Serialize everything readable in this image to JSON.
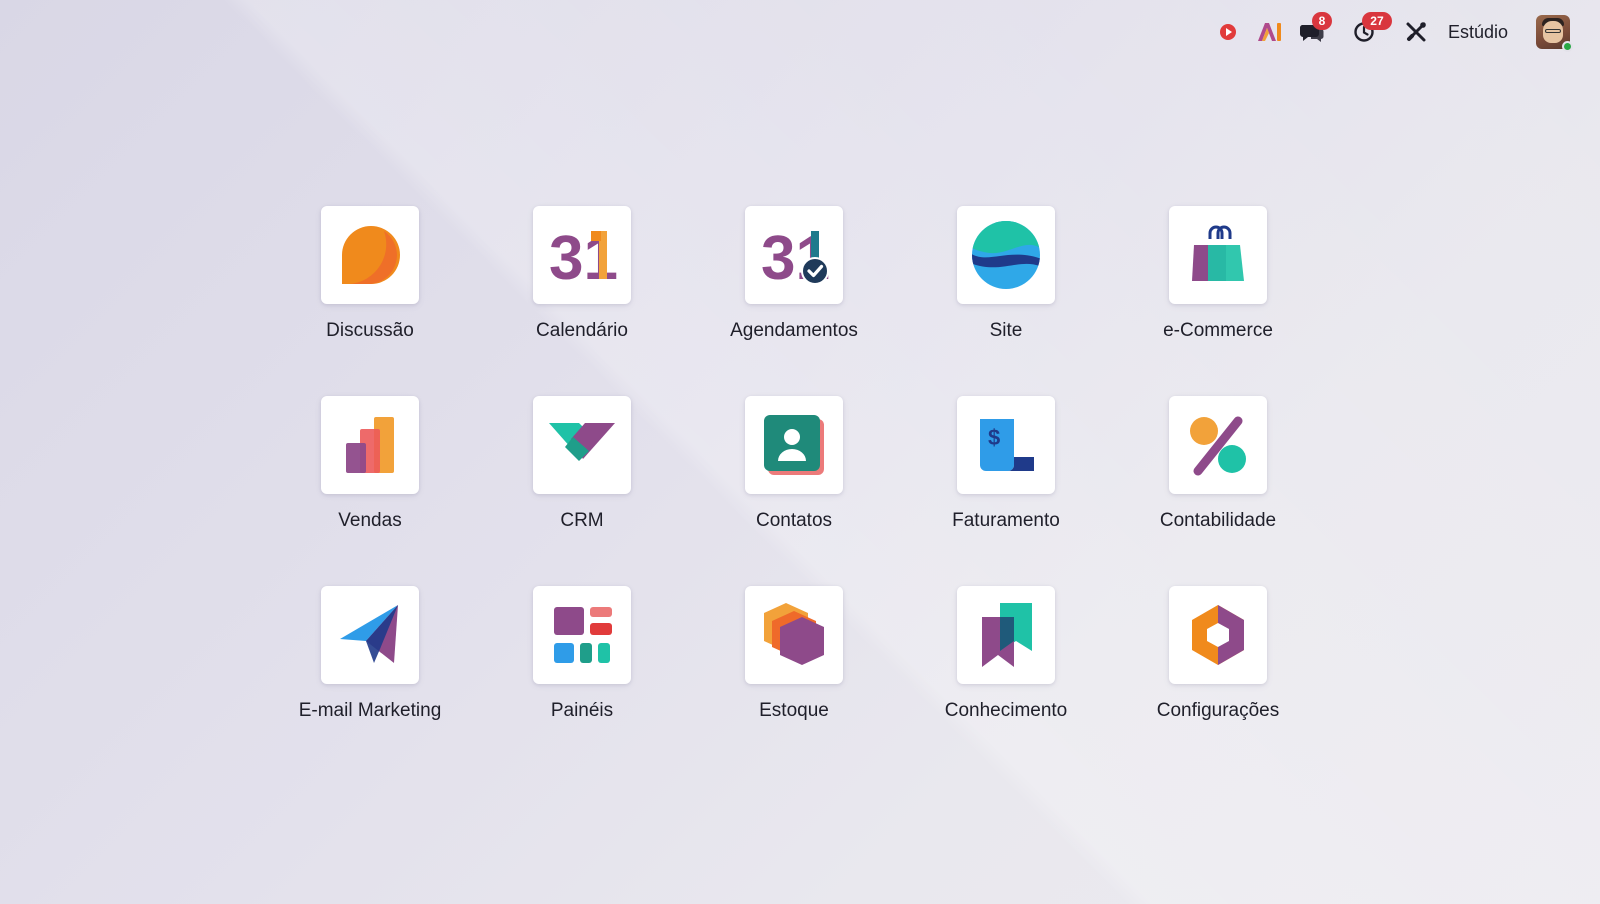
{
  "topbar": {
    "icons": [
      "record-icon",
      "ai-icon",
      "chat-icon",
      "activity-clock-icon",
      "studio-tools-icon"
    ],
    "messages_count": "8",
    "activities_count": "27",
    "studio_label": "Estúdio"
  },
  "apps": [
    {
      "label": "Discussão",
      "icon": "discuss-icon"
    },
    {
      "label": "Calendário",
      "icon": "calendar-icon"
    },
    {
      "label": "Agendamentos",
      "icon": "appointments-icon"
    },
    {
      "label": "Site",
      "icon": "website-icon"
    },
    {
      "label": "e-Commerce",
      "icon": "ecommerce-icon"
    },
    {
      "label": "Vendas",
      "icon": "sales-icon"
    },
    {
      "label": "CRM",
      "icon": "crm-icon"
    },
    {
      "label": "Contatos",
      "icon": "contacts-icon"
    },
    {
      "label": "Faturamento",
      "icon": "invoicing-icon"
    },
    {
      "label": "Contabilidade",
      "icon": "accounting-icon"
    },
    {
      "label": "E-mail Marketing",
      "icon": "email-marketing-icon"
    },
    {
      "label": "Painéis",
      "icon": "dashboards-icon"
    },
    {
      "label": "Estoque",
      "icon": "inventory-icon"
    },
    {
      "label": "Conhecimento",
      "icon": "knowledge-icon"
    },
    {
      "label": "Configurações",
      "icon": "settings-icon"
    }
  ],
  "calendar_icon_text": "31",
  "invoice_icon_symbol": "$",
  "colors": {
    "badge": "#d9363e",
    "orange": "#f08a1c",
    "purple": "#8e4a8a",
    "teal": "#1fc2a7",
    "blue": "#2f9ce8",
    "navy": "#1f3a8a",
    "red": "#ec5a5a"
  }
}
